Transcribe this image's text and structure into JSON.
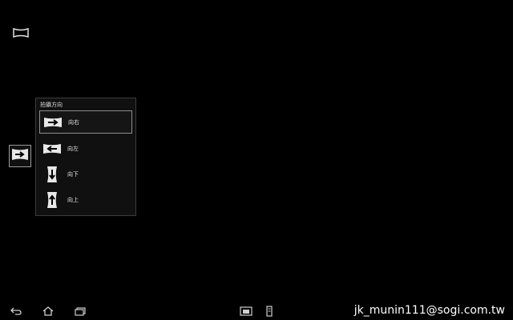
{
  "menu": {
    "title": "拍攝方向",
    "items": [
      {
        "label": "向右",
        "icon": "arrow-right-icon",
        "selected": true
      },
      {
        "label": "向左",
        "icon": "arrow-left-icon",
        "selected": false
      },
      {
        "label": "向下",
        "icon": "arrow-down-icon",
        "selected": false
      },
      {
        "label": "向上",
        "icon": "arrow-up-icon",
        "selected": false
      }
    ]
  },
  "toggle": {
    "icon": "arrow-right-icon"
  },
  "mode": {
    "icon": "panorama-icon"
  },
  "nav": {
    "back_icon": "back-icon",
    "home_icon": "home-icon",
    "recent_icon": "recent-apps-icon",
    "screenshot_icon": "screenshot-icon",
    "phone_icon": "phone-icon"
  },
  "watermark": "jk_munin111@sogi.com.tw",
  "colors": {
    "background": "#000000",
    "panel": "#101010",
    "selected_border": "#8e8e8e"
  }
}
